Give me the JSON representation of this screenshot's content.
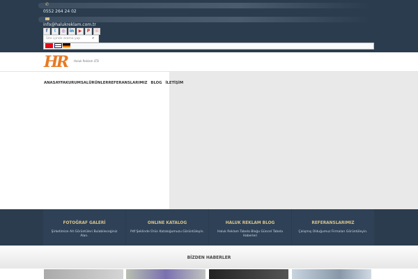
{
  "contact": {
    "phone": "0552 264 24 02",
    "email": "info@halukreklam.com.tr",
    "phone_icon": "phone-icon",
    "mail_icon": "mail-icon"
  },
  "social": [
    {
      "name": "facebook",
      "glyph": "f",
      "color": "#3b5998"
    },
    {
      "name": "twitter",
      "glyph": "t",
      "color": "#55acee"
    },
    {
      "name": "instagram",
      "glyph": "◎",
      "color": "#8a3ab9"
    },
    {
      "name": "linkedin",
      "glyph": "in",
      "color": "#0077b5"
    },
    {
      "name": "youtube",
      "glyph": "▶",
      "color": "#e52d27"
    },
    {
      "name": "pinterest",
      "glyph": "P",
      "color": "#cb2027"
    },
    {
      "name": "whatsapp",
      "glyph": "☏",
      "color": "#e07070"
    }
  ],
  "search": {
    "placeholder": "Site içinde arama yap"
  },
  "languages": [
    "tr",
    "en",
    "de"
  ],
  "logo": {
    "text": "HR",
    "subtitle": "Haluk Reklam LTD"
  },
  "nav": [
    "ANASAYFA",
    "KURUMSAL",
    "ÜRÜNLER",
    "REFERANSLARIMIZ",
    "BLOG",
    "İLETİŞİM"
  ],
  "features": [
    {
      "title": "FOTOĞRAF GALERİ",
      "desc": "Şirketimize Ait Görüntüleri Bulabileceğiniz Alan."
    },
    {
      "title": "ONLINE KATALOG",
      "desc": "Pdf Şeklinde Ürün Kataloğumuzu Görüntüleyin."
    },
    {
      "title": "HALUK REKLAM BLOG",
      "desc": "Haluk Reklam Tabela Bloğu Güncel Tabela Haberleri"
    },
    {
      "title": "REFERANSLARIMIZ",
      "desc": "Çalışmış Olduğumuz Firmaları Görüntüleyin."
    }
  ],
  "news": {
    "title": "BİZDEN HABERLER"
  }
}
